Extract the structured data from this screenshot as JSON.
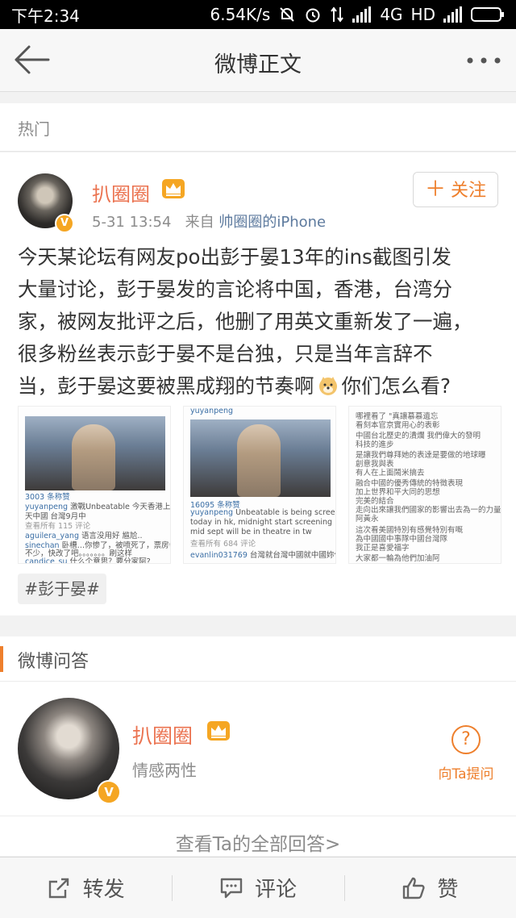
{
  "status_bar": {
    "time": "下午2:34",
    "speed": "6.54K/s",
    "network": "4G",
    "hd": "HD"
  },
  "nav": {
    "title": "微博正文",
    "back_icon": "arrow-left-icon",
    "more_icon": "more-dots-icon"
  },
  "hot_label": "热门",
  "post": {
    "username": "扒圈圈",
    "badge": "V",
    "time": "5-31 13:54",
    "source_prefix": "来自",
    "source": "帅圈圈的iPhone",
    "follow_label": "关注",
    "lines": [
      "今天某论坛有网友po出彭于晏13年的ins截图引发",
      "大量讨论，彭于晏发的言论将中国，香港，台湾分",
      "家，被网友批评之后，他删了用英文重新发了一遍，",
      "很多粉丝表示彭于晏不是台独，只是当年言辞不",
      "当，彭于晏这要被黑成翔的节奏啊",
      "你们怎么看?"
    ],
    "topic": "#彭于晏#",
    "images": [
      {
        "likes": "3003 条称赞",
        "caption_user": "yuyanpeng",
        "caption": "激戰Unbeatable 今天香港上映 明",
        "caption2": "天中國 台灣9月中",
        "view_comments": "查看所有 115 评论",
        "c1_user": "aguilera_yang",
        "c1": "语言没用好 尴尬..",
        "c2_user": "sinechan",
        "c2": "卧槽…你惨了，被喷死了，票房会减",
        "c2b": "不少，快改了吧。。。。。。。刷这样",
        "c3_user": "candice_su",
        "c3": "什么个意思？要分家阿?"
      },
      {
        "header_user": "yuyanpeng",
        "likes": "16095 条称赞",
        "caption_user": "yuyanpeng",
        "caption": "Unbeatable is being screened",
        "caption2": "today in hk, midnight start screening in china,",
        "caption3": "mid sept will be in theatre in tw",
        "view_comments": "查看所有 684 评论",
        "c1_user": "evanlin031769",
        "c1": "台灣就台灣中國就中國妳什麼"
      },
      {
        "lines": [
          "哪裡看了 \"真讓慕慕遺忘",
          "看刻本官京實用心的表彰",
          "中國台北歷史的潰爛  我們偉大的發明",
          "科技的進步",
          "是讓我們尊拜她的表達是要做的地球曝",
          "創意我與表",
          "有人在上面鬧米搞去",
          "融合中國的優秀傳統的特徵表現",
          "加上世界和平大同的思想",
          "完美的結合",
          "走向出來讓我們國家的影響出去為一的力量",
          "阿黃永",
          "這次看美國特別有感覺特別有嘅",
          "為中國國中事隊中國台灣隊",
          "我正是喜愛福字",
          "大家都一輪為他們加油阿"
        ]
      }
    ]
  },
  "qa": {
    "section_title": "微博问答",
    "name": "扒圈圈",
    "description": "情感两性",
    "ask_label": "向Ta提问",
    "see_all": "查看Ta的全部回答>"
  },
  "tabbar": {
    "repost": "转发",
    "comment": "评论",
    "like": "赞"
  },
  "colors": {
    "accent_orange": "#eb7350",
    "link_blue": "#5d7a9e",
    "badge_gold": "#f5a623"
  }
}
